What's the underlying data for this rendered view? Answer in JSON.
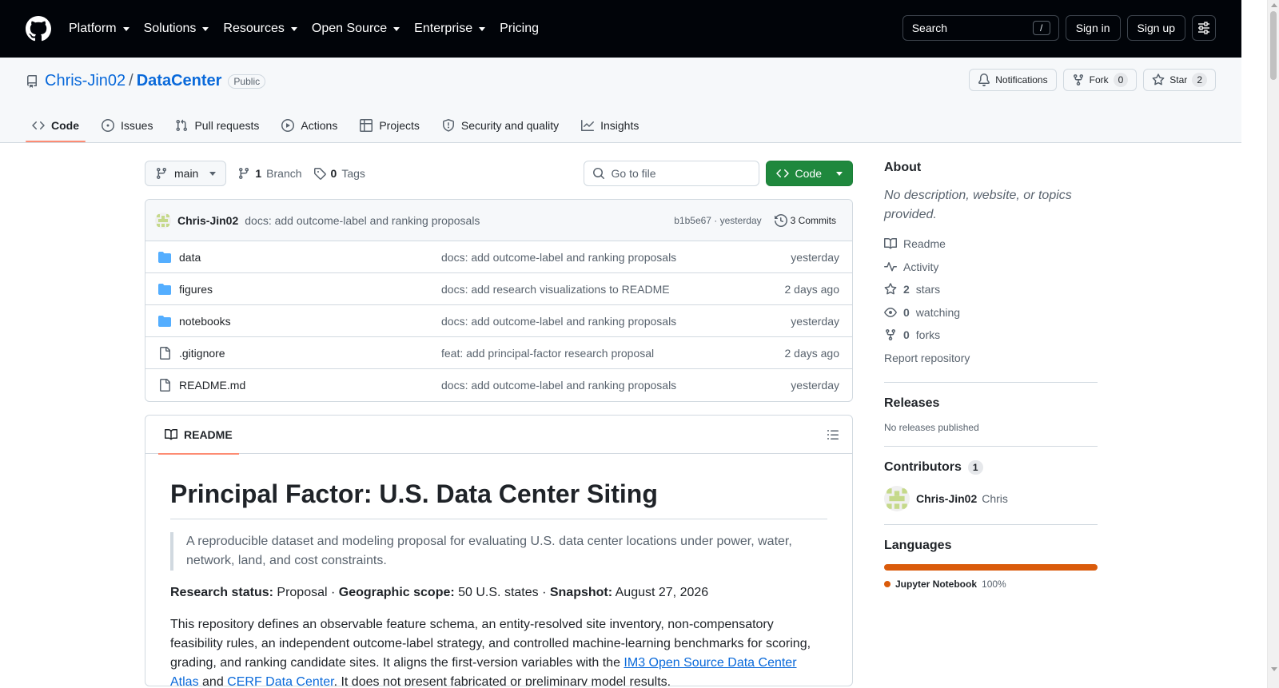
{
  "header": {
    "nav": [
      "Platform",
      "Solutions",
      "Resources",
      "Open Source",
      "Enterprise",
      "Pricing"
    ],
    "search_label": "Search",
    "search_key": "/",
    "sign_in": "Sign in",
    "sign_up": "Sign up"
  },
  "repo": {
    "owner": "Chris-Jin02",
    "separator": "/",
    "name": "DataCenter",
    "visibility": "Public",
    "notifications": "Notifications",
    "fork_label": "Fork",
    "fork_count": "0",
    "star_label": "Star",
    "star_count": "2"
  },
  "tabs": [
    "Code",
    "Issues",
    "Pull requests",
    "Actions",
    "Projects",
    "Security and quality",
    "Insights"
  ],
  "toolbar": {
    "branch": "main",
    "branch_count": "1",
    "branch_label": "Branch",
    "tag_count": "0",
    "tag_label": "Tags",
    "goto_placeholder": "Go to file",
    "code_button": "Code"
  },
  "commit": {
    "author": "Chris-Jin02",
    "message": "docs: add outcome-label and ranking proposals",
    "meta": "b1b5e67 · yesterday",
    "commits_label": "3 Commits"
  },
  "files": [
    {
      "type": "dir",
      "name": "data",
      "message": "docs: add outcome-label and ranking proposals",
      "date": "yesterday"
    },
    {
      "type": "dir",
      "name": "figures",
      "message": "docs: add research visualizations to README",
      "date": "2 days ago"
    },
    {
      "type": "dir",
      "name": "notebooks",
      "message": "docs: add outcome-label and ranking proposals",
      "date": "yesterday"
    },
    {
      "type": "file",
      "name": ".gitignore",
      "message": "feat: add principal-factor research proposal",
      "date": "2 days ago"
    },
    {
      "type": "file",
      "name": "README.md",
      "message": "docs: add outcome-label and ranking proposals",
      "date": "yesterday"
    }
  ],
  "readme": {
    "tab_label": "README",
    "title": "Principal Factor: U.S. Data Center Siting",
    "quote": "A reproducible dataset and modeling proposal for evaluating U.S. data center locations under power, water, network, land, and cost constraints.",
    "status_label": "Research status:",
    "status_value": " Proposal · ",
    "scope_label": "Geographic scope:",
    "scope_value": " 50 U.S. states · ",
    "snapshot_label": "Snapshot:",
    "snapshot_value": " August 27, 2026",
    "para_text": "This repository defines an observable feature schema, an entity-resolved site inventory, non-compensatory feasibility rules, an independent outcome-label strategy, and controlled machine-learning benchmarks for scoring, grading, and ranking candidate sites. It aligns the first-version variables with the ",
    "link1": "IM3 Open Source Data Center Atlas",
    "and_text": " and ",
    "link2": "CERF Data Center",
    "tail_text": ". It does not present fabricated or preliminary model results."
  },
  "sidebar": {
    "about_title": "About",
    "about_desc": "No description, website, or topics provided.",
    "readme": "Readme",
    "activity": "Activity",
    "stars_count": "2",
    "stars_label": "stars",
    "watching_count": "0",
    "watching_label": "watching",
    "forks_count": "0",
    "forks_label": "forks",
    "report": "Report repository",
    "releases_title": "Releases",
    "releases_desc": "No releases published",
    "contributors_title": "Contributors",
    "contributors_count": "1",
    "contributor_login": "Chris-Jin02",
    "contributor_name": "Chris",
    "languages_title": "Languages",
    "language_name": "Jupyter Notebook",
    "language_pct": "100%",
    "language_color": "#DA5B0B"
  }
}
